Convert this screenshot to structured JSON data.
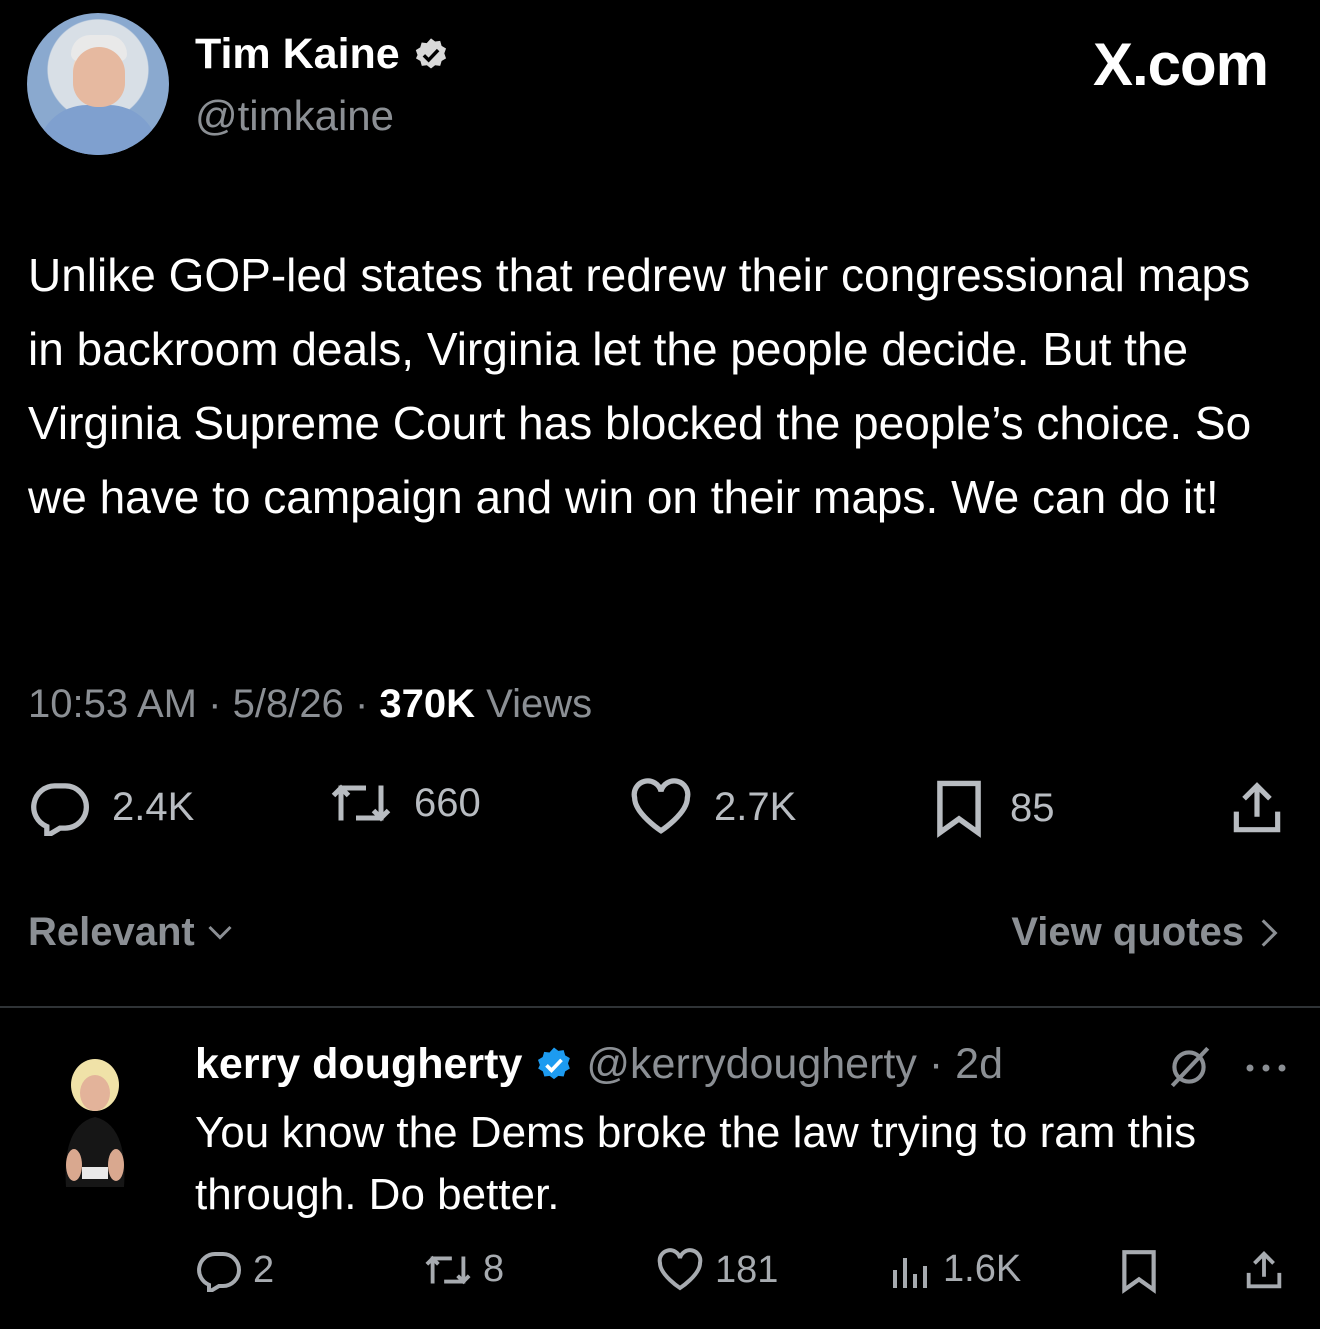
{
  "brand": "X.com",
  "tweet": {
    "author_name": "Tim Kaine",
    "author_handle": "@timkaine",
    "text": "Unlike GOP-led states that redrew their congressional maps in backroom deals, Virginia let the people decide. But the Virginia Supreme Court has blocked the people’s choice. So we have to campaign and win on their maps. We can do it!",
    "time": "10:53 AM",
    "sep": "·",
    "date": "5/8/26",
    "views_count": "370K",
    "views_label": "Views",
    "replies": "2.4K",
    "reposts": "660",
    "likes": "2.7K",
    "bookmarks": "85"
  },
  "filters": {
    "sort_label": "Relevant",
    "quotes_label": "View quotes"
  },
  "reply": {
    "author_name": "kerry dougherty",
    "author_handle": "@kerrydougherty",
    "sep": "·",
    "age": "2d",
    "text": "You know the Dems broke the law trying to ram this through. Do better.",
    "replies": "2",
    "reposts": "8",
    "likes": "181",
    "views": "1.6K"
  },
  "colors": {
    "background": "#000000",
    "verified": "#1d9bf0",
    "muted": "#8b8f94"
  }
}
